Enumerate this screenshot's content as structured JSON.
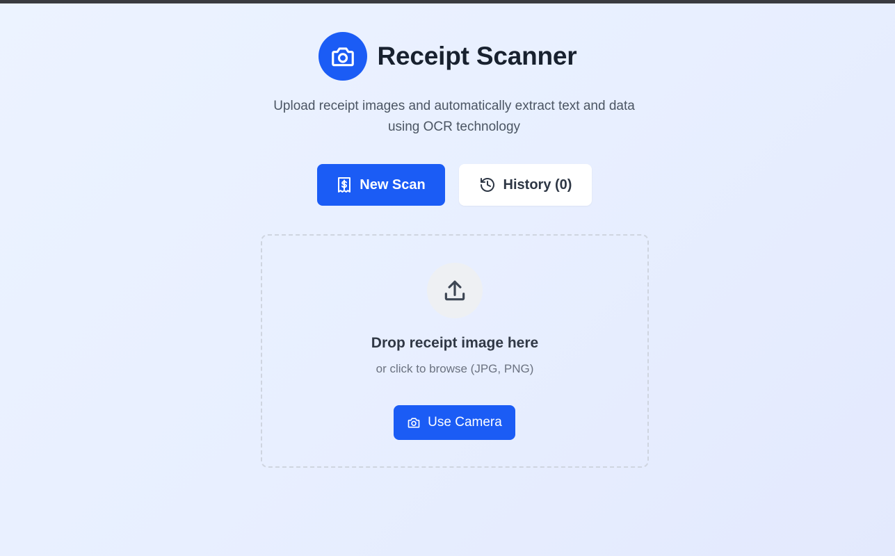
{
  "app": {
    "title": "Receipt Scanner",
    "subtitle": "Upload receipt images and automatically extract text and data using OCR technology",
    "logo_icon": "camera-icon"
  },
  "tabs": {
    "new_scan": {
      "label": "New Scan",
      "icon": "receipt-dollar-icon",
      "active": true
    },
    "history": {
      "label": "History (0)",
      "icon": "history-icon",
      "active": false
    }
  },
  "dropzone": {
    "icon": "upload-icon",
    "title": "Drop receipt image here",
    "hint": "or click to browse (JPG, PNG)",
    "camera_button": {
      "label": "Use Camera",
      "icon": "camera-icon"
    }
  },
  "colors": {
    "accent": "#1b5cf5",
    "heading": "#18212f",
    "muted": "#6b7280"
  }
}
